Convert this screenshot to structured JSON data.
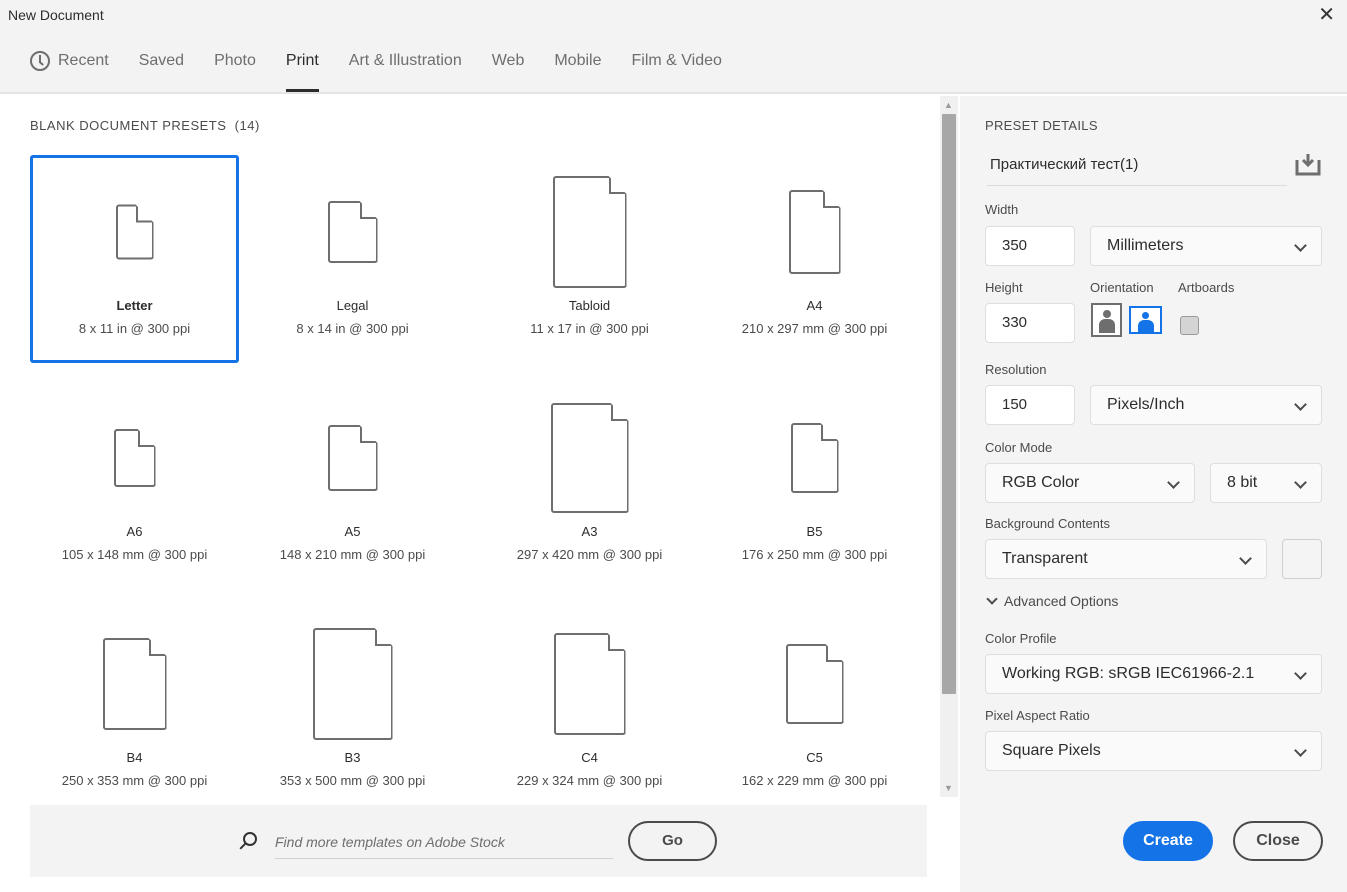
{
  "window": {
    "title": "New Document"
  },
  "tabs": [
    {
      "label": "Recent"
    },
    {
      "label": "Saved"
    },
    {
      "label": "Photo"
    },
    {
      "label": "Print"
    },
    {
      "label": "Art & Illustration"
    },
    {
      "label": "Web"
    },
    {
      "label": "Mobile"
    },
    {
      "label": "Film & Video"
    }
  ],
  "presets": {
    "title": "BLANK DOCUMENT PRESETS",
    "count": "(14)",
    "items": [
      {
        "name": "Letter",
        "desc": "8 x 11 in @ 300 ppi"
      },
      {
        "name": "Legal",
        "desc": "8 x 14 in @ 300 ppi"
      },
      {
        "name": "Tabloid",
        "desc": "11 x 17 in @ 300 ppi"
      },
      {
        "name": "A4",
        "desc": "210 x 297 mm @ 300 ppi"
      },
      {
        "name": "A6",
        "desc": "105 x 148 mm @ 300 ppi"
      },
      {
        "name": "A5",
        "desc": "148 x 210 mm @ 300 ppi"
      },
      {
        "name": "A3",
        "desc": "297 x 420 mm @ 300 ppi"
      },
      {
        "name": "B5",
        "desc": "176 x 250 mm @ 300 ppi"
      },
      {
        "name": "B4",
        "desc": "250 x 353 mm @ 300 ppi"
      },
      {
        "name": "B3",
        "desc": "353 x 500 mm @ 300 ppi"
      },
      {
        "name": "C4",
        "desc": "229 x 324 mm @ 300 ppi"
      },
      {
        "name": "C5",
        "desc": "162 x 229 mm @ 300 ppi"
      }
    ]
  },
  "stock": {
    "placeholder": "Find more templates on Adobe Stock",
    "go": "Go"
  },
  "details": {
    "title": "PRESET DETAILS",
    "name": "Практический тест(1)",
    "width_label": "Width",
    "width": "350",
    "width_unit": "Millimeters",
    "height_label": "Height",
    "height": "330",
    "orientation_label": "Orientation",
    "artboards_label": "Artboards",
    "resolution_label": "Resolution",
    "resolution": "150",
    "resolution_unit": "Pixels/Inch",
    "color_mode_label": "Color Mode",
    "color_mode": "RGB Color",
    "bit_depth": "8 bit",
    "bg_label": "Background Contents",
    "bg": "Transparent",
    "advanced": "Advanced Options",
    "profile_label": "Color Profile",
    "profile": "Working RGB: sRGB IEC61966-2.1",
    "par_label": "Pixel Aspect Ratio",
    "par": "Square Pixels"
  },
  "buttons": {
    "create": "Create",
    "close": "Close"
  },
  "colors": {
    "accent": "#1473e6"
  }
}
